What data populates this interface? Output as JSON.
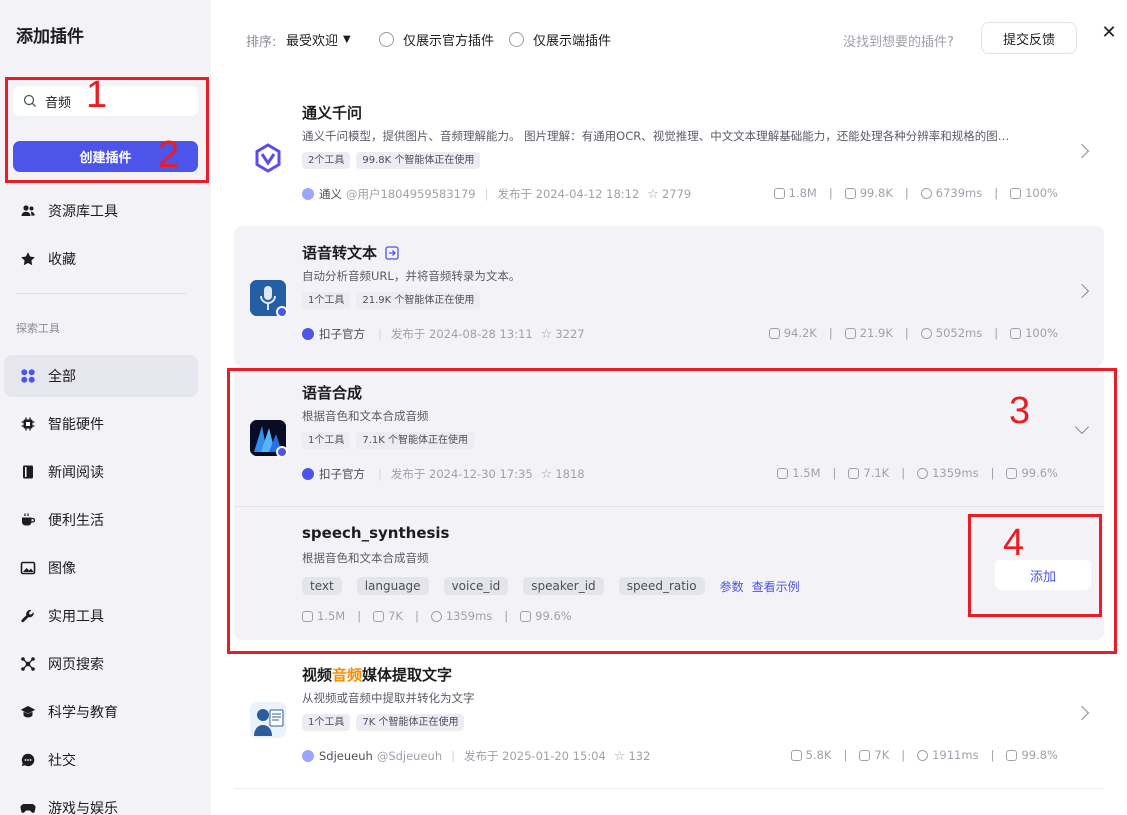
{
  "sidebar": {
    "title": "添加插件",
    "search": {
      "value": "音频",
      "placeholder": ""
    },
    "create_label": "创建插件",
    "top_items": [
      {
        "label": "资源库工具",
        "icon": "users-icon"
      },
      {
        "label": "收藏",
        "icon": "star-icon"
      }
    ],
    "section_label": "探索工具",
    "items": [
      {
        "label": "全部",
        "icon": "grid-icon",
        "active": true
      },
      {
        "label": "智能硬件",
        "icon": "chip-icon"
      },
      {
        "label": "新闻阅读",
        "icon": "book-icon"
      },
      {
        "label": "便利生活",
        "icon": "coffee-icon"
      },
      {
        "label": "图像",
        "icon": "image-icon"
      },
      {
        "label": "实用工具",
        "icon": "wrench-icon"
      },
      {
        "label": "网页搜索",
        "icon": "network-icon"
      },
      {
        "label": "科学与教育",
        "icon": "graduation-cap-icon"
      },
      {
        "label": "社交",
        "icon": "chat-icon"
      },
      {
        "label": "游戏与娱乐",
        "icon": "gamepad-icon"
      }
    ]
  },
  "topbar": {
    "sort_label": "排序:",
    "sort_value": "最受欢迎",
    "radio_official": "仅展示官方插件",
    "radio_client": "仅展示端插件",
    "hint": "没找到想要的插件?",
    "feedback_label": "提交反馈"
  },
  "plugins": [
    {
      "title": "通义千问",
      "desc": "通义千问模型，提供图片、音频理解能力。 图片理解：有通用OCR、视觉推理、中文文本理解基础能力，还能处理各种分辨率和规格的图…",
      "tag_tools": "2个工具",
      "tag_usage": "99.8K 个智能体正在使用",
      "author": "通义",
      "handle": "@用户1804959583179",
      "published": "发布于 2024-04-12 18:12",
      "stars": "2779",
      "calls": "1.8M",
      "bots": "99.8K",
      "latency": "6739ms",
      "success": "100%"
    },
    {
      "title": "语音转文本",
      "desc": "自动分析音频URL，并将音频转录为文本。",
      "tag_tools": "1个工具",
      "tag_usage": "21.9K 个智能体正在使用",
      "author": "扣子官方",
      "published": "发布于 2024-08-28 13:11",
      "stars": "3227",
      "calls": "94.2K",
      "bots": "21.9K",
      "latency": "5052ms",
      "success": "100%"
    },
    {
      "title": "语音合成",
      "desc": "根据音色和文本合成音频",
      "tag_tools": "1个工具",
      "tag_usage": "7.1K 个智能体正在使用",
      "author": "扣子官方",
      "published": "发布于 2024-12-30 17:35",
      "stars": "1818",
      "calls": "1.5M",
      "bots": "7.1K",
      "latency": "1359ms",
      "success": "99.6%"
    },
    {
      "title_pre": "视频",
      "title_hl": "音频",
      "title_post": "媒体提取文字",
      "desc": "从视频或音频中提取并转化为文字",
      "tag_tools": "1个工具",
      "tag_usage": "7K 个智能体正在使用",
      "author": "Sdjeueuh",
      "handle": "@Sdjeueuh",
      "published": "发布于 2025-01-20 15:04",
      "stars": "132",
      "calls": "5.8K",
      "bots": "7K",
      "latency": "1911ms",
      "success": "99.8%"
    }
  ],
  "tool": {
    "name": "speech_synthesis",
    "desc": "根据音色和文本合成音频",
    "params": [
      "text",
      "language",
      "voice_id",
      "speaker_id",
      "speed_ratio"
    ],
    "params_link": "参数",
    "example_link": "查看示例",
    "calls": "1.5M",
    "bots": "7K",
    "latency": "1359ms",
    "success": "99.6%",
    "add_label": "添加"
  },
  "annotations": [
    "1",
    "2",
    "3",
    "4"
  ],
  "colors": {
    "accent": "#4c54e9",
    "annotation": "#ea1c24",
    "highlight": "#ff8c00"
  }
}
